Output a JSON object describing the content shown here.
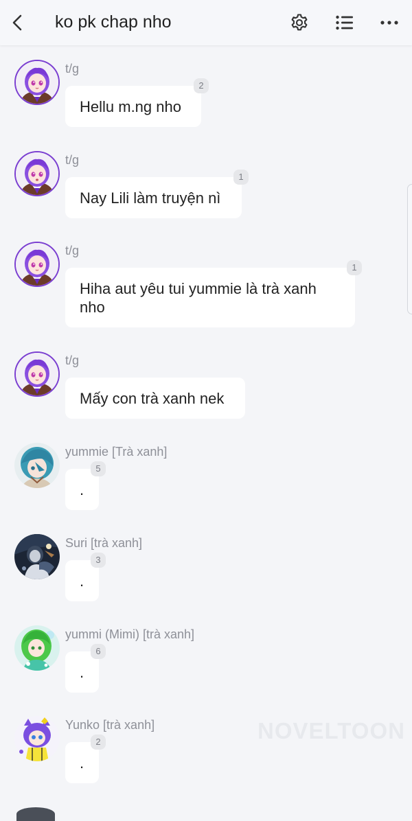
{
  "header": {
    "title": "ko pk chap nho",
    "back_icon": "chevron-left-icon",
    "settings_icon": "gear-icon",
    "list_icon": "list-icon",
    "more_icon": "more-horizontal-icon"
  },
  "messages": [
    {
      "sender": "t/g",
      "text": "Hellu m.ng nho",
      "badge": "2",
      "avatar": "purple-hair-girl"
    },
    {
      "sender": "t/g",
      "text": "Nay Lili làm truyện nì",
      "badge": "1",
      "avatar": "purple-hair-girl"
    },
    {
      "sender": "t/g",
      "text": "Hiha aut yêu tui yummie là trà xanh nho",
      "badge": "1",
      "avatar": "purple-hair-girl"
    },
    {
      "sender": "t/g",
      "text": "Mấy con trà xanh nek",
      "badge": "",
      "avatar": "purple-hair-girl"
    },
    {
      "sender": "yummie [Trà xanh]",
      "text": ".",
      "badge": "5",
      "avatar": "blue-hair-girl"
    },
    {
      "sender": "Suri [trà xanh]",
      "text": ".",
      "badge": "3",
      "avatar": "dark-figure"
    },
    {
      "sender": "yummi (Mimi) [trà xanh]",
      "text": ".",
      "badge": "6",
      "avatar": "green-hair-girl"
    },
    {
      "sender": "Yunko [trà xanh]",
      "text": ".",
      "badge": "2",
      "avatar": "purple-cat-girl"
    }
  ],
  "watermark": "NOVELTOON",
  "colors": {
    "background": "#f4f5f8",
    "bubble": "#ffffff",
    "sender_text": "#8e9098",
    "badge_bg": "#e6e7ea"
  }
}
